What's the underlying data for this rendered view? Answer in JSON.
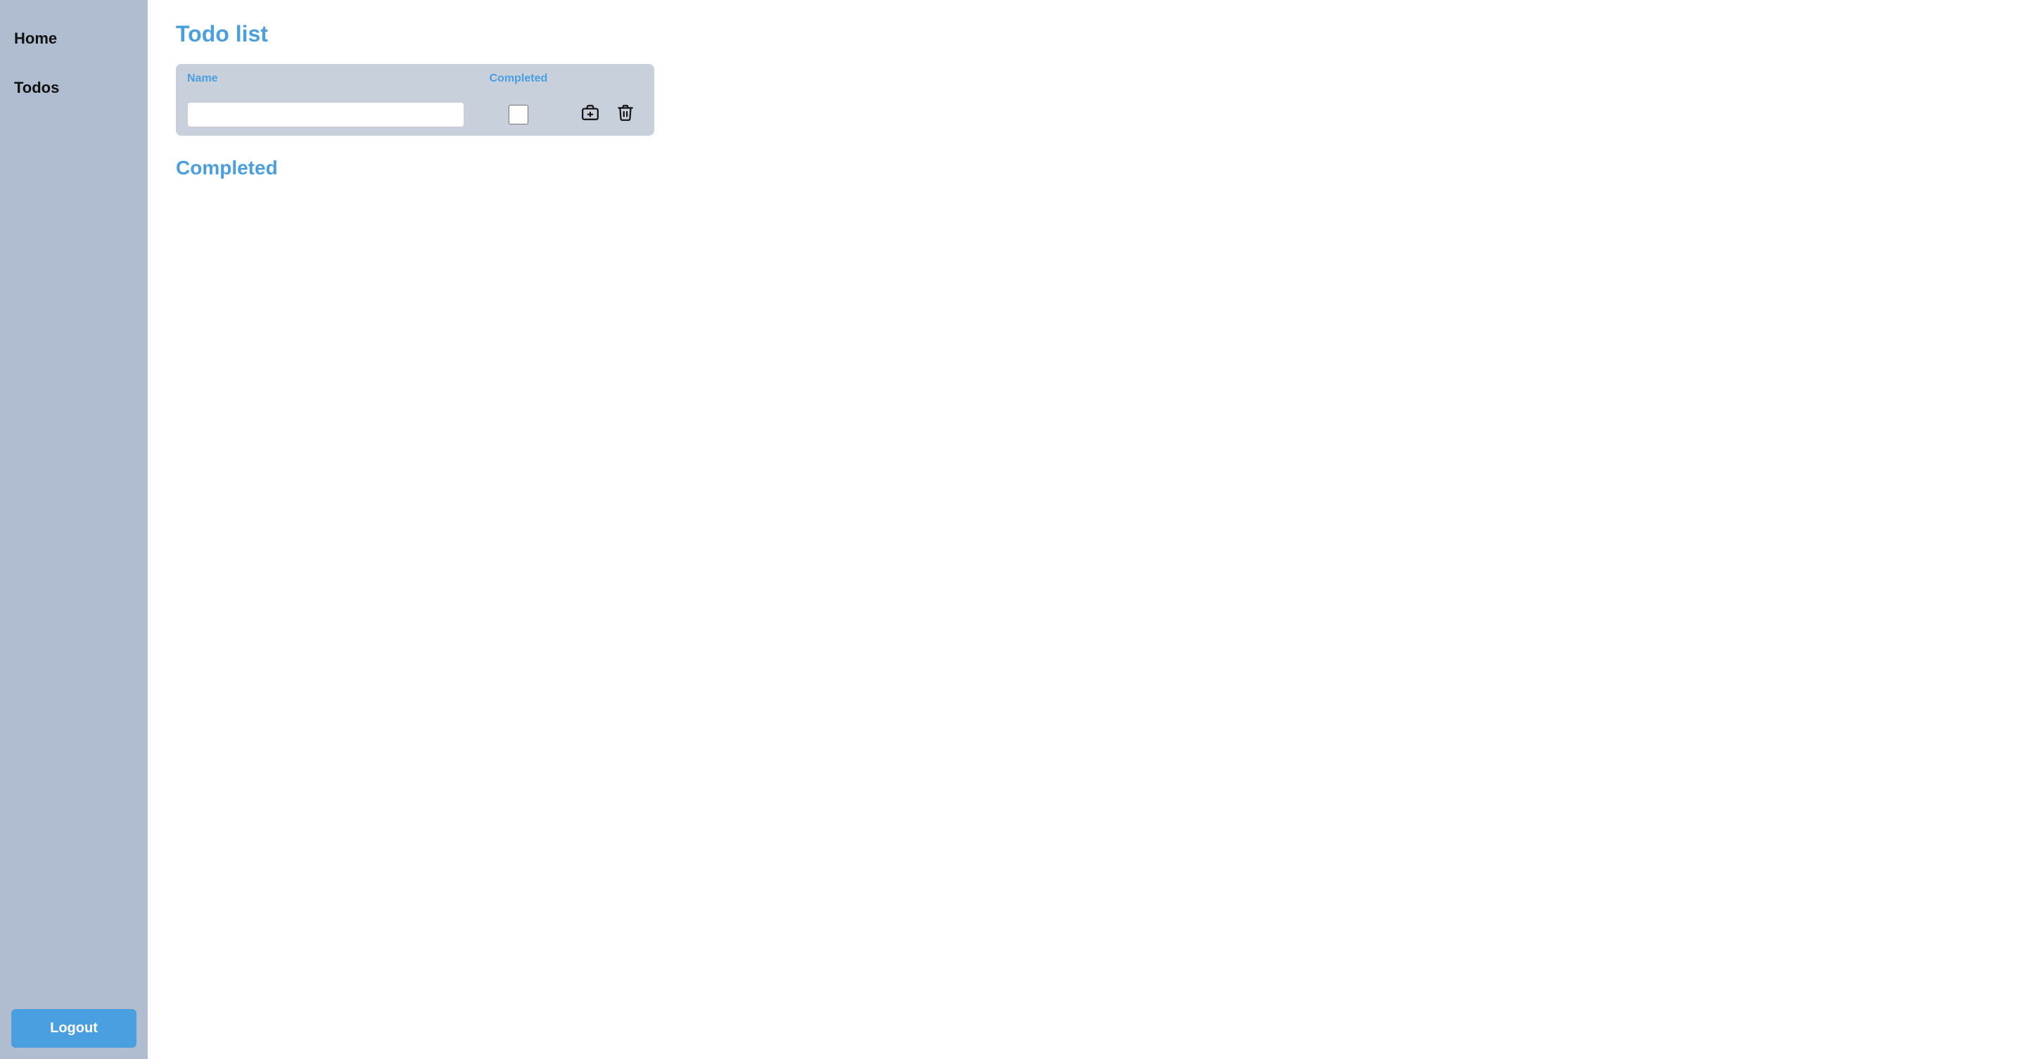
{
  "sidebar": {
    "items": [
      {
        "label": "Home",
        "name": "home"
      },
      {
        "label": "Todos",
        "name": "todos"
      }
    ],
    "logout_label": "Logout"
  },
  "main": {
    "page_title": "Todo list",
    "table": {
      "col_name": "Name",
      "col_completed": "Completed",
      "name_placeholder": "",
      "rows": []
    },
    "completed_section_title": "Completed"
  },
  "icons": {
    "save": "💼",
    "delete": "🗑"
  }
}
